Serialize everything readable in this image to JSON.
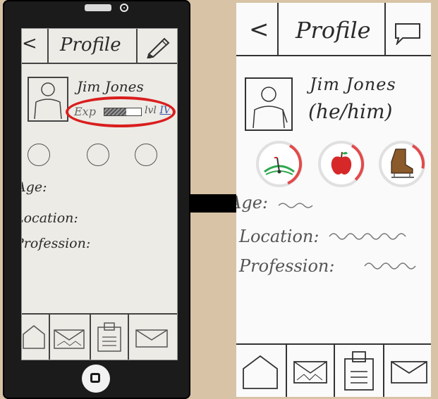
{
  "left_sketch": {
    "header": {
      "back_glyph": "<",
      "title": "Profile",
      "edit_icon": "pencil-icon"
    },
    "profile": {
      "name": "Jim Jones",
      "exp_label": "Exp",
      "exp_progress": 0.6,
      "level_prefix": "lvl",
      "level_value": "IV",
      "highlight_color": "#d91e1e"
    },
    "badges_count": 3,
    "fields": [
      "Age:",
      "Location:",
      "Profession:"
    ],
    "nav_icons": [
      "home-icon",
      "mail-open-icon",
      "clipboard-icon",
      "mail-icon"
    ]
  },
  "right_sketch": {
    "header": {
      "back_glyph": "<",
      "title": "Profile",
      "chat_icon": "chat-icon"
    },
    "profile": {
      "name": "Jim Jones",
      "pronouns": "(he/him)"
    },
    "badges": [
      {
        "icon": "gauge-icon",
        "color": "#2fa84f",
        "progress": 0.35
      },
      {
        "icon": "apple-icon",
        "color": "#d62828",
        "progress": 0.3
      },
      {
        "icon": "skate-icon",
        "color": "#8b5a2b",
        "progress": 0.2
      }
    ],
    "fields": [
      "Age:",
      "Location:",
      "Profession:"
    ],
    "nav_icons": [
      "home-icon",
      "mail-open-icon",
      "clipboard-icon",
      "mail-icon"
    ]
  },
  "arrow": {
    "icon": "arrow-right-icon",
    "color": "#000000"
  }
}
